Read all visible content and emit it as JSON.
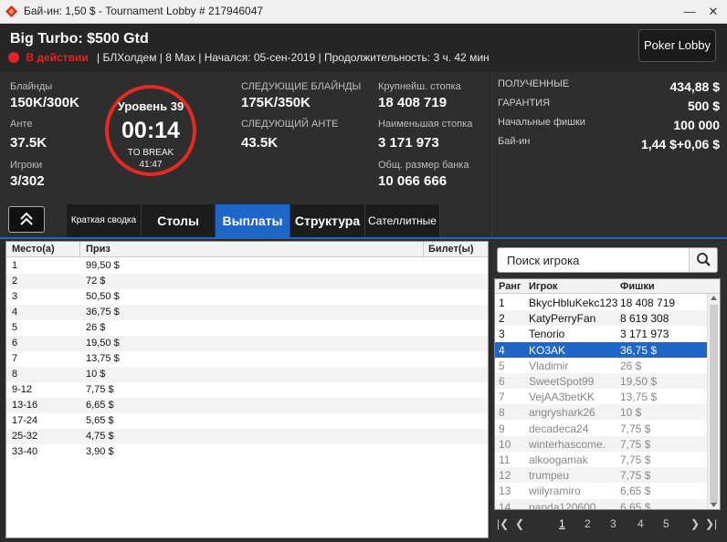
{
  "window": {
    "title": "Бай-ин: 1,50 $ - Tournament Lobby # 217946047"
  },
  "header": {
    "tournament_name": "Big Turbo: $500 Gtd",
    "status": "В действии",
    "details": "| БЛХолдем | 8 Max | Начался: 05-сен-2019 | Продолжительность: 3 ч. 42 мин",
    "poker_lobby_label": "Poker Lobby"
  },
  "info": {
    "blinds_label": "Блайнды",
    "blinds": "150K/300K",
    "ante_label": "Анте",
    "ante": "37.5K",
    "players_label": "Игроки",
    "players": "3/302",
    "next_blinds_label": "СЛЕДУЮЩИЕ БЛАЙНДЫ",
    "next_blinds": "175K/350K",
    "next_ante_label": "СЛЕДУЮЩИЙ АНТЕ",
    "next_ante": "43.5K",
    "largest_stack_label": "Крупнейш. стопка",
    "largest_stack": "18 408 719",
    "smallest_stack_label": "Наименьшая стопка",
    "smallest_stack": "3 171 973",
    "total_pot_label": "Общ. размер банка",
    "total_pot": "10 066 666"
  },
  "clock": {
    "level": "Уровень 39",
    "time": "00:14",
    "to_break_label": "TO BREAK",
    "to_break": "41:47"
  },
  "prize": {
    "received_label": "ПОЛУЧЕННЫЕ",
    "received": "434,88 $",
    "guarantee_label": "ГАРАНТИЯ",
    "guarantee": "500 $",
    "start_chips_label": "Начальные фишки",
    "start_chips": "100 000",
    "buyin_label": "Бай-ин",
    "buyin": "1,44 $+0,06 $"
  },
  "tabs": [
    {
      "label": "Краткая сводка"
    },
    {
      "label": "Столы"
    },
    {
      "label": "Выплаты"
    },
    {
      "label": "Структура"
    },
    {
      "label": "Сателлитные"
    }
  ],
  "payouts": {
    "col_place": "Место(а)",
    "col_prize": "Приз",
    "col_ticket": "Билет(ы)",
    "rows": [
      {
        "place": "1",
        "prize": "99,50 $"
      },
      {
        "place": "2",
        "prize": "72 $"
      },
      {
        "place": "3",
        "prize": "50,50 $"
      },
      {
        "place": "4",
        "prize": "36,75 $"
      },
      {
        "place": "5",
        "prize": "26 $"
      },
      {
        "place": "6",
        "prize": "19,50 $"
      },
      {
        "place": "7",
        "prize": "13,75 $"
      },
      {
        "place": "8",
        "prize": "10 $"
      },
      {
        "place": "9-12",
        "prize": "7,75 $"
      },
      {
        "place": "13-16",
        "prize": "6,65 $"
      },
      {
        "place": "17-24",
        "prize": "5,65 $"
      },
      {
        "place": "25-32",
        "prize": "4,75 $"
      },
      {
        "place": "33-40",
        "prize": "3,90 $"
      }
    ]
  },
  "players": {
    "search_placeholder": "Поиск игрока",
    "col_rank": "Ранг",
    "col_player": "Игрок",
    "col_chips": "Фишки",
    "rows": [
      {
        "rank": "1",
        "player": "BkycHbluKekc123",
        "chips": "18 408 719"
      },
      {
        "rank": "2",
        "player": "KatyPerryFan",
        "chips": "8 619 308"
      },
      {
        "rank": "3",
        "player": "Tenorio",
        "chips": "3 171 973"
      },
      {
        "rank": "4",
        "player": "KO3AK",
        "chips": "36,75 $"
      },
      {
        "rank": "5",
        "player": "Vladimir",
        "chips": "26 $"
      },
      {
        "rank": "6",
        "player": "SweetSpot99",
        "chips": "19,50 $"
      },
      {
        "rank": "7",
        "player": "VejAA3betKK",
        "chips": "13,75 $"
      },
      {
        "rank": "8",
        "player": "angryshark26",
        "chips": "10 $"
      },
      {
        "rank": "9",
        "player": "decadeca24",
        "chips": "7,75 $"
      },
      {
        "rank": "10",
        "player": "winterhascome.",
        "chips": "7,75 $"
      },
      {
        "rank": "11",
        "player": "alkoogamak",
        "chips": "7,75 $"
      },
      {
        "rank": "12",
        "player": "trumpeu",
        "chips": "7,75 $"
      },
      {
        "rank": "13",
        "player": "wiilyramiro",
        "chips": "6,65 $"
      },
      {
        "rank": "14",
        "player": "panda120600",
        "chips": "6,65 $"
      }
    ],
    "pages": [
      "1",
      "2",
      "3",
      "4",
      "5"
    ]
  }
}
